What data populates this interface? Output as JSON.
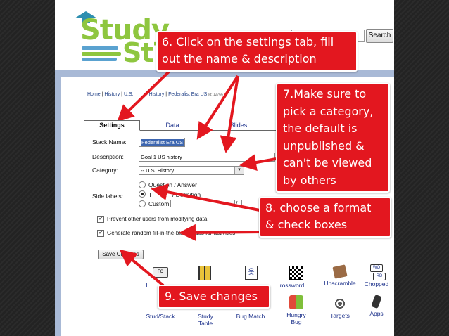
{
  "header": {
    "logo_word_1": "Study",
    "logo_word_2": "St",
    "search_button": "Search",
    "logo_colors": [
      "#8ec63f",
      "#2e8fb0",
      "#5aa2d0"
    ]
  },
  "breadcrumb": {
    "home": "Home",
    "history": "History",
    "us_history_start": "U.S.",
    "us_history_end": "History",
    "current": "Federalist Era US",
    "stack_id": "id: 12766",
    "separator": "|"
  },
  "tabs": {
    "settings": "Settings",
    "data": "Data",
    "slides": "Slides"
  },
  "form": {
    "stack_name_label": "Stack Name:",
    "stack_name_value": "Federalist Era US",
    "description_label": "Description:",
    "description_value": "Goal 1 US history",
    "category_label": "Category:",
    "category_value": "-- U.S. History",
    "side_labels_label": "Side labels:",
    "side_option_1": "Question / Answer",
    "side_option_2_start": "T",
    "side_option_2_end": "/ Definition",
    "side_option_3": "Custom",
    "custom_separator": "/",
    "prevent_label": "Prevent other users from modifying data",
    "generate_label": "Generate random fill-in-the-blank clues for activities",
    "save_button": "Save Changes"
  },
  "games": [
    {
      "label": "F",
      "icon": "flashcards-icon",
      "badge": "FC"
    },
    {
      "label": "",
      "icon": "matching-icon"
    },
    {
      "label": "",
      "icon": "hangman-icon"
    },
    {
      "label": "rossword",
      "icon": "crossword-icon"
    },
    {
      "label": "Unscramble",
      "icon": "unscramble-icon"
    },
    {
      "label": "Chopped",
      "icon": "chopped-icon",
      "badge_1": "WO",
      "badge_2": "RD"
    },
    {
      "label": "Stud/Stack",
      "icon": "studystack-icon"
    },
    {
      "label": "Study\nTable",
      "icon": "study-table-icon"
    },
    {
      "label": "Bug Match",
      "icon": "bug-match-icon"
    },
    {
      "label": "Hungry\nBug",
      "icon": "hungry-bug-icon"
    },
    {
      "label": "Targets",
      "icon": "targets-icon"
    },
    {
      "label": "Apps",
      "icon": "apps-icon"
    }
  ],
  "callouts": {
    "c6": [
      "6. Click on the settings tab, fill",
      "out the name & description"
    ],
    "c7": [
      "7.Make sure to",
      "pick a category,",
      "the default is",
      "unpublished &",
      "can't be viewed",
      "by others"
    ],
    "c8": [
      "8. choose a format",
      "& check boxes"
    ],
    "c9": [
      "9. Save changes"
    ],
    "color": "#e3171f"
  }
}
